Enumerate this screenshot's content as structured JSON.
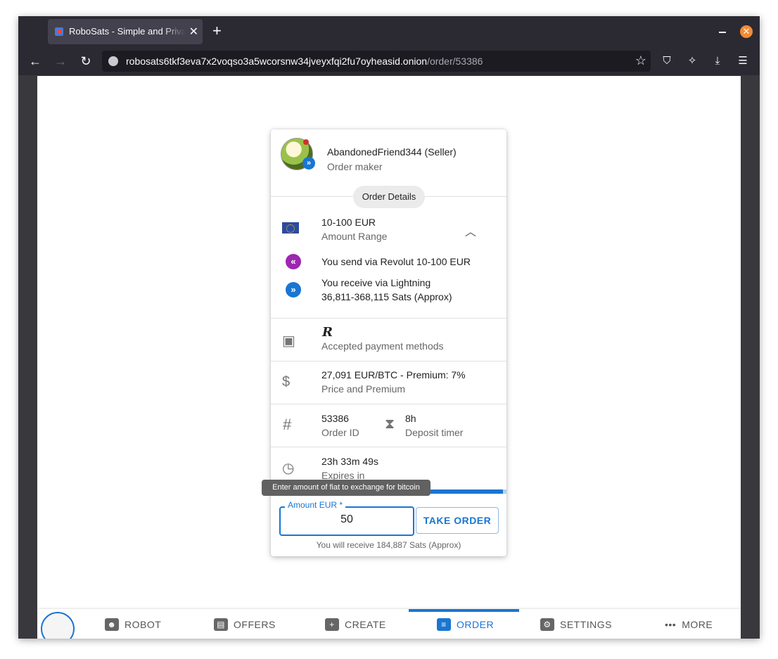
{
  "browser": {
    "tab_title": "RoboSats - Simple and Private Bitcoin Exchange",
    "url_host": "robosats6tkf3eva7x2voqso3a5wcorsnw34jveyxfqi2fu7oyheasid.onion",
    "url_path": "/order/53386"
  },
  "maker": {
    "name": "AbandonedFriend344 (Seller)",
    "role": "Order maker"
  },
  "order_details_chip": "Order Details",
  "amount": {
    "value": "10-100 EUR",
    "label": "Amount Range",
    "send": "You send via Revolut 10-100 EUR",
    "receive_line1": "You receive via Lightning",
    "receive_line2": "36,811-368,115 Sats (Approx)"
  },
  "payment": {
    "logo": "R",
    "label": "Accepted payment methods"
  },
  "price": {
    "value": "27,091 EUR/BTC - Premium: 7%",
    "label": "Price and Premium"
  },
  "order_id": {
    "value": "53386",
    "label": "Order ID"
  },
  "deposit": {
    "value": "8h",
    "label": "Deposit timer"
  },
  "expires": {
    "value": "23h 33m 49s",
    "label": "Expires in",
    "progress_fraction": 0.98
  },
  "tooltip": "Enter amount of fiat to exchange for bitcoin",
  "take": {
    "input_label": "Amount EUR *",
    "input_value": "50",
    "button": "TAKE ORDER",
    "receive_text": "You will receive 184,887 Sats (Approx)"
  },
  "bottom_nav": {
    "robot": "ROBOT",
    "offers": "OFFERS",
    "create": "CREATE",
    "order": "ORDER",
    "settings": "SETTINGS",
    "more": "MORE"
  },
  "colors": {
    "primary": "#1976d2",
    "send_icon": "#9c27b0",
    "receive_icon": "#1976d2",
    "firefox_close": "#f38b35"
  }
}
